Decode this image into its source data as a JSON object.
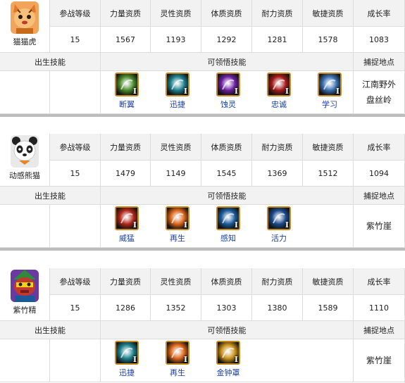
{
  "headers": [
    "参战等级",
    "力量资质",
    "灵性资质",
    "体质资质",
    "耐力资质",
    "敏捷资质",
    "成长率"
  ],
  "labels": {
    "birth_skill": "出生技能",
    "learnable_skill": "可领悟技能",
    "capture": "捕捉地点"
  },
  "roman_numeral": "I",
  "pets": [
    {
      "name": "猫猫虎",
      "avatar_icon": "tiger-cat-avatar",
      "stats": [
        "15",
        "1567",
        "1193",
        "1292",
        "1281",
        "1578",
        "1083"
      ],
      "skills": [
        {
          "name": "断翼",
          "icon": "broken-wing-icon",
          "color": "#4a8a2a"
        },
        {
          "name": "迅捷",
          "icon": "swift-icon",
          "color": "#1d7f8c"
        },
        {
          "name": "蚀灵",
          "icon": "soul-corrode-icon",
          "color": "#6a1fa0"
        },
        {
          "name": "忠诚",
          "icon": "loyalty-icon",
          "color": "#a61a1a"
        },
        {
          "name": "学习",
          "icon": "learning-icon",
          "color": "#3a6fb0"
        }
      ],
      "capture": [
        "江南野外",
        "盘丝岭"
      ]
    },
    {
      "name": "动感熊猫",
      "avatar_icon": "panda-avatar",
      "stats": [
        "15",
        "1479",
        "1149",
        "1545",
        "1369",
        "1512",
        "1094"
      ],
      "skills": [
        {
          "name": "威猛",
          "icon": "mighty-icon",
          "color": "#b1261a"
        },
        {
          "name": "再生",
          "icon": "regen-icon",
          "color": "#d9641a"
        },
        {
          "name": "感知",
          "icon": "perception-icon",
          "color": "#1a5a9a"
        },
        {
          "name": "活力",
          "icon": "vitality-icon",
          "color": "#1a4a8a"
        }
      ],
      "capture": [
        "紫竹崖"
      ]
    },
    {
      "name": "紫竹精",
      "avatar_icon": "bamboo-spirit-avatar",
      "stats": [
        "15",
        "1286",
        "1352",
        "1303",
        "1380",
        "1589",
        "1110"
      ],
      "skills": [
        {
          "name": "迅捷",
          "icon": "swift-icon",
          "color": "#1d7f8c"
        },
        {
          "name": "再生",
          "icon": "regen-icon",
          "color": "#d9641a"
        },
        {
          "name": "金钟罩",
          "icon": "golden-bell-icon",
          "color": "#c8901a"
        }
      ],
      "capture": [
        "紫竹崖"
      ]
    }
  ]
}
